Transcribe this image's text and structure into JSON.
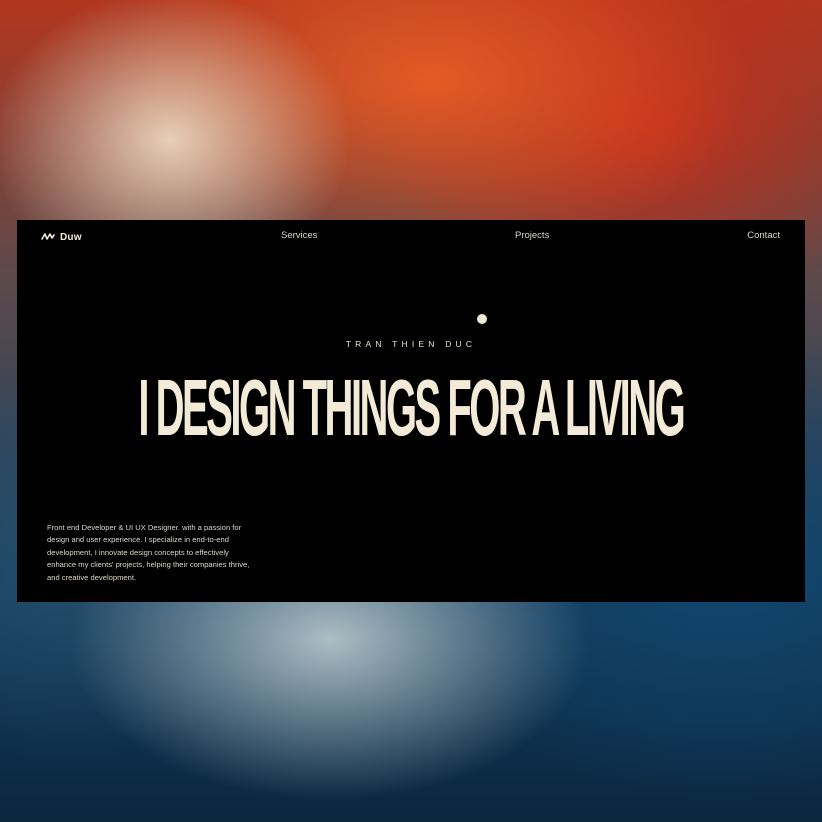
{
  "nav": {
    "brand": "Duw",
    "links": [
      "Services",
      "Projects",
      "Contact"
    ]
  },
  "hero": {
    "eyebrow": "TRAN THIEN DUC",
    "headline": "I DESIGN THINGS FOR A LIVING",
    "bio": "Front end Developer & UI UX Designer. with a passion for design and user experience. I specialize in end-to-end development, I innovate design concepts to effectively enhance my clients' projects, helping their companies thrive, and creative development."
  },
  "colors": {
    "page_bg": "#000000",
    "text_cream": "#f3ebd7",
    "backdrop_orange": "#e85c24",
    "backdrop_blue": "#12466e"
  },
  "icons": {
    "logo": "brand-mark-icon",
    "dot": "cursor-dot-icon"
  }
}
